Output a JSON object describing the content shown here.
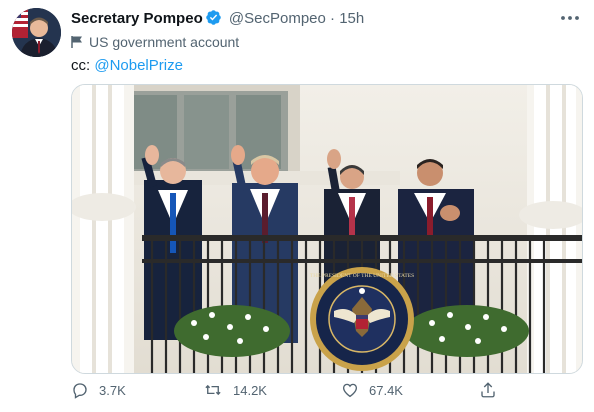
{
  "tweet": {
    "author_name": "Secretary Pompeo",
    "handle": "@SecPompeo",
    "separator": "·",
    "time": "15h",
    "account_label": "US government account",
    "text_prefix": "cc:",
    "mention": "@NobelPrize",
    "verified_icon": "verified-badge-icon",
    "more_icon": "more-options-icon"
  },
  "media": {
    "seal_text": "THE PRESIDENT OF THE UNITED STATES"
  },
  "actions": {
    "reply_count": "3.7K",
    "retweet_count": "14.2K",
    "like_count": "67.4K"
  },
  "colors": {
    "link": "#1d9bf0",
    "secondary_text": "#536471",
    "border": "#cfd9de"
  }
}
